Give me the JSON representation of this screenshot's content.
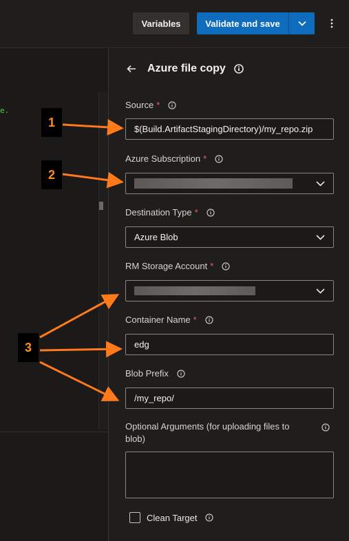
{
  "toolbar": {
    "variables_label": "Variables",
    "validate_label": "Validate and save"
  },
  "editor": {
    "code_fragment": "e."
  },
  "panel": {
    "title": "Azure file copy",
    "fields": {
      "source": {
        "label": "Source",
        "required": "*",
        "value": "$(Build.ArtifactStagingDirectory)/my_repo.zip"
      },
      "subscription": {
        "label": "Azure Subscription",
        "required": "*",
        "value": ""
      },
      "destination_type": {
        "label": "Destination Type",
        "required": "*",
        "value": "Azure Blob"
      },
      "storage_account": {
        "label": "RM Storage Account",
        "required": "*",
        "value": ""
      },
      "container_name": {
        "label": "Container Name",
        "required": "*",
        "value": "edg"
      },
      "blob_prefix": {
        "label": "Blob Prefix",
        "value": "/my_repo/"
      },
      "optional_arguments": {
        "label": "Optional Arguments (for uploading files to blob)",
        "value": ""
      },
      "clean_target": {
        "label": "Clean Target",
        "checked": false
      }
    }
  },
  "callouts": [
    "1",
    "2",
    "3"
  ],
  "colors": {
    "accent": "#0f6cbd",
    "required": "#e26060",
    "callout_arrow": "#ff7a1a",
    "callout_text": "#ff8c1a"
  }
}
